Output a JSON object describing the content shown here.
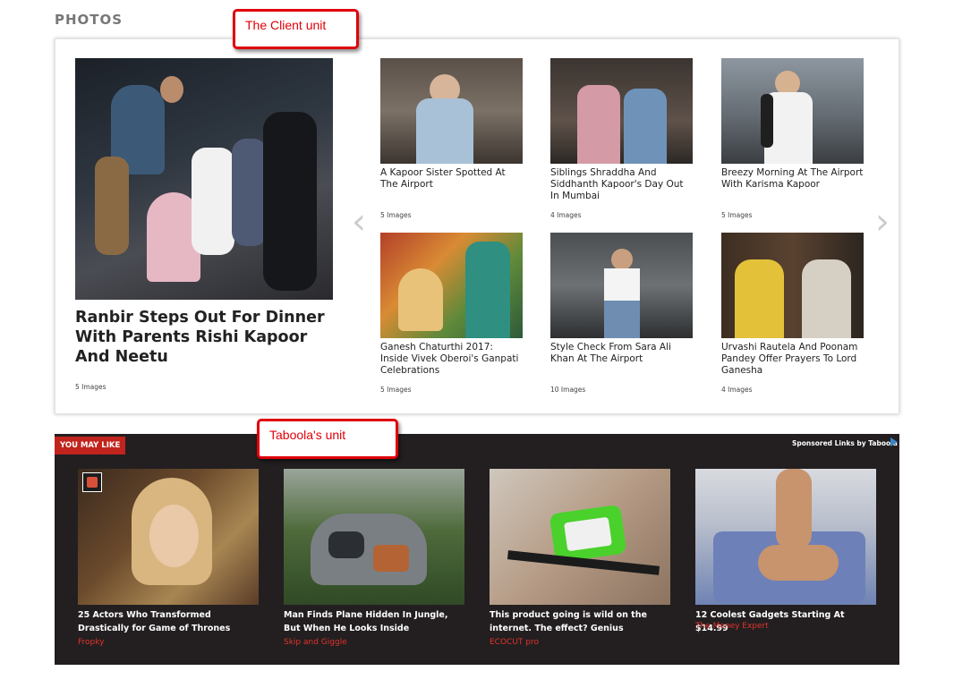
{
  "section_title": "PHOTOS",
  "callouts": {
    "client": "The Client unit",
    "taboola": "Taboola's unit"
  },
  "featured": {
    "title": "Ranbir Steps Out For Dinner With Parents Rishi Kapoor And Neetu",
    "count": "5 Images"
  },
  "galleries": [
    {
      "title": "A Kapoor Sister Spotted At The Airport",
      "count": "5 Images"
    },
    {
      "title": "Siblings Shraddha And Siddhanth Kapoor's Day Out In Mumbai",
      "count": "4 Images"
    },
    {
      "title": "Breezy Morning At The Airport With Karisma Kapoor",
      "count": "5 Images"
    },
    {
      "title": "Ganesh Chaturthi 2017: Inside Vivek Oberoi's Ganpati Celebrations",
      "count": "5 Images"
    },
    {
      "title": "Style Check From Sara Ali Khan At The Airport",
      "count": "10 Images"
    },
    {
      "title": "Urvashi Rautela And Poonam Pandey Offer Prayers To Lord Ganesha",
      "count": "4 Images"
    }
  ],
  "nav": {
    "prev_icon": "chevron-left-icon",
    "next_icon": "chevron-right-icon"
  },
  "taboola": {
    "label": "YOU MAY LIKE",
    "sponsored": "Sponsored Links by Taboola",
    "items": [
      {
        "title": "25 Actors Who Transformed Drastically for Game of Thrones",
        "source": "Fropky"
      },
      {
        "title": "Man Finds Plane Hidden In Jungle, But When He Looks Inside",
        "source": "Skip and Giggle"
      },
      {
        "title": "This product going is wild on the internet. The effect? Genius",
        "source": "ECOCUT pro"
      },
      {
        "title": "12 Coolest Gadgets Starting At $14.99",
        "source": "The Money Expert"
      }
    ]
  },
  "colors": {
    "callout_red": "#e0000a",
    "taboola_bg": "#231f20",
    "label_red": "#c1241d",
    "source_red": "#e0332b"
  }
}
